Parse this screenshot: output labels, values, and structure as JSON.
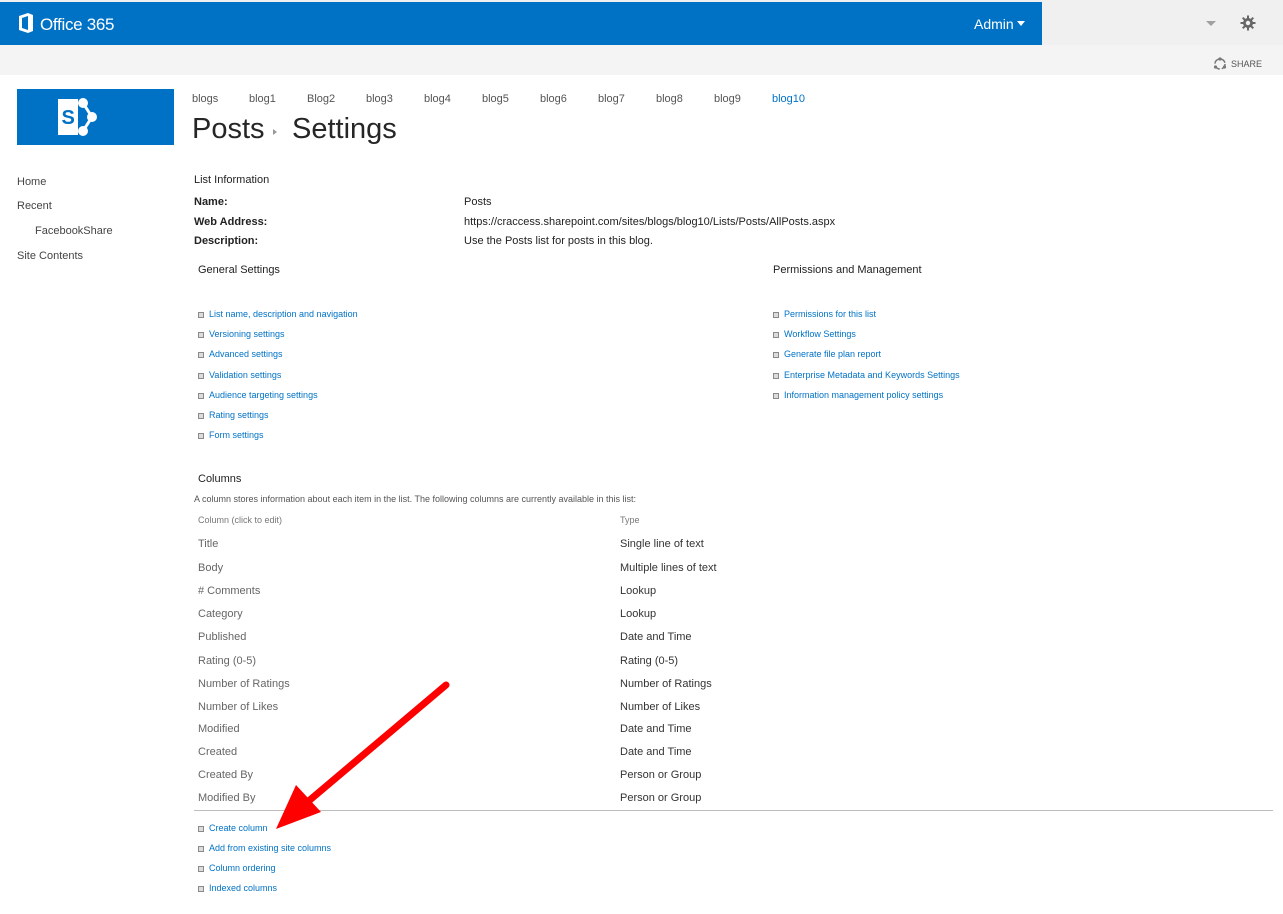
{
  "suite": {
    "app_title": "Office 365",
    "user": "Admin",
    "share": "SHARE"
  },
  "topnav": [
    "blogs",
    "blog1",
    "Blog2",
    "blog3",
    "blog4",
    "blog5",
    "blog6",
    "blog7",
    "blog8",
    "blog9",
    "blog10"
  ],
  "topnav_selected": "blog10",
  "page": {
    "title_parent": "Posts",
    "title_current": "Settings"
  },
  "quicklaunch": [
    "Home",
    "Recent",
    "FacebookShare",
    "Site Contents"
  ],
  "list_info": {
    "heading": "List Information",
    "name_label": "Name:",
    "name_value": "Posts",
    "web_label": "Web Address:",
    "web_value": "https://craccess.sharepoint.com/sites/blogs/blog10/Lists/Posts/AllPosts.aspx",
    "desc_label": "Description:",
    "desc_value": "Use the Posts list for posts in this blog."
  },
  "general": {
    "heading": "General Settings",
    "links": [
      "List name, description and navigation",
      "Versioning settings",
      "Advanced settings",
      "Validation settings",
      "Audience targeting settings",
      "Rating settings",
      "Form settings"
    ]
  },
  "permissions": {
    "heading": "Permissions and Management",
    "links": [
      "Permissions for this list",
      "Workflow Settings",
      "Generate file plan report",
      "Enterprise Metadata and Keywords Settings",
      "Information management policy settings"
    ]
  },
  "columns": {
    "heading": "Columns",
    "note": "A column stores information about each item in the list. The following columns are currently available in this list:",
    "header_column": "Column (click to edit)",
    "header_type": "Type",
    "rows": [
      {
        "name": "Title",
        "type": "Single line of text"
      },
      {
        "name": "Body",
        "type": "Multiple lines of text"
      },
      {
        "name": "# Comments",
        "type": "Lookup"
      },
      {
        "name": "Category",
        "type": "Lookup"
      },
      {
        "name": "Published",
        "type": "Date and Time"
      },
      {
        "name": "Rating (0-5)",
        "type": "Rating (0-5)"
      },
      {
        "name": "Number of Ratings",
        "type": "Number of Ratings"
      },
      {
        "name": "Number of Likes",
        "type": "Number of Likes"
      },
      {
        "name": "Modified",
        "type": "Date and Time"
      },
      {
        "name": "Created",
        "type": "Date and Time"
      },
      {
        "name": "Created By",
        "type": "Person or Group"
      },
      {
        "name": "Modified By",
        "type": "Person or Group"
      }
    ],
    "actions": [
      "Create column",
      "Add from existing site columns",
      "Column ordering",
      "Indexed columns"
    ]
  },
  "colors": {
    "brand_blue": "#0072c6",
    "annotation_red": "#ff0000"
  },
  "icons": [
    "office-logo-icon",
    "chevron-down-icon",
    "gear-icon",
    "share-icon",
    "sharepoint-logo-icon",
    "annotation-arrow"
  ]
}
